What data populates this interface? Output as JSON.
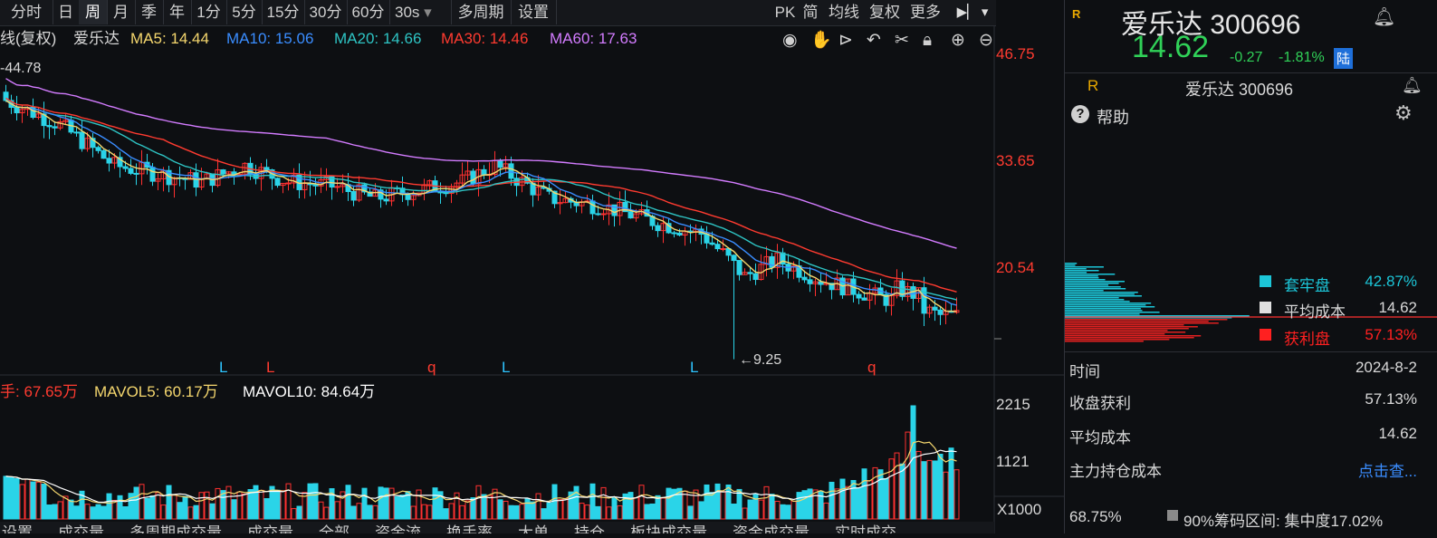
{
  "toolbar": {
    "items": [
      {
        "label": "分时"
      },
      {
        "label": "日"
      },
      {
        "label": "周"
      },
      {
        "label": "月"
      },
      {
        "label": "季"
      },
      {
        "label": "年"
      },
      {
        "label": "1分"
      },
      {
        "label": "5分"
      },
      {
        "label": "15分"
      },
      {
        "label": "30分"
      },
      {
        "label": "60分"
      },
      {
        "label": "30s"
      },
      {
        "label": "多周期"
      },
      {
        "label": "设置"
      }
    ],
    "right_items": [
      {
        "label": "PK"
      },
      {
        "label": "简"
      },
      {
        "label": "均线"
      },
      {
        "label": "复权"
      },
      {
        "label": "更多"
      }
    ],
    "active": "周"
  },
  "legend": {
    "prefix": "线(复权)",
    "name": "爱乐达",
    "ma5": "MA5: 14.44",
    "ma10": "MA10: 15.06",
    "ma20": "MA20: 14.66",
    "ma30": "MA30: 14.46",
    "ma60": "MA60: 17.63"
  },
  "vol_legend": {
    "vol": "手: 67.65万",
    "mavol5": "MAVOL5: 60.17万",
    "mavol10": "MAVOL10: 84.64万"
  },
  "colors": {
    "ma5": "#f5d76e",
    "ma10": "#3a8dff",
    "ma20": "#2ec4c4",
    "ma30": "#ff3b30",
    "ma60": "#d37cff",
    "up": "#ff3030",
    "down": "#2ad4e8",
    "axis_text": "#ff3b30"
  },
  "chart_data": {
    "type": "candlestick",
    "price_axis_ticks": [
      "46.75",
      "33.65",
      "20.54"
    ],
    "volume_axis_ticks": [
      "2215",
      "1121"
    ],
    "volume_unit": "X1000",
    "high_mark": "44.78",
    "low_mark": "9.25",
    "signal_marks": [
      "L",
      "L",
      "q",
      "L",
      "L",
      "q"
    ]
  },
  "right_panel": {
    "r_badge": "R",
    "stock_name": "爱乐达 300696",
    "price": "14.62",
    "change": "-0.27",
    "change_pct": "-1.81%",
    "lu_badge": "陆",
    "sub_name": "爱乐达 300696",
    "help": "帮助",
    "legend": [
      {
        "label": "套牢盘",
        "value": "42.87%",
        "color": "#1cc6d8"
      },
      {
        "label": "平均成本",
        "value": "14.62",
        "color": "#e0e0e0"
      },
      {
        "label": "获利盘",
        "value": "57.13%",
        "color": "#ff2020"
      }
    ],
    "info": [
      {
        "label": "时间",
        "value": "2024-8-2"
      },
      {
        "label": "收盘获利",
        "value": "57.13%"
      },
      {
        "label": "平均成本",
        "value": "14.62"
      },
      {
        "label": "主力持仓成本",
        "value": "点击查..."
      }
    ],
    "footer_left": "68.75%",
    "footer_mid": "90%筹码区间: 集中度17.02%"
  },
  "bottom_tabs": [
    "设置",
    "成交量",
    "多周期成交量",
    "成交量",
    "全部",
    "资金流",
    "换手率",
    "大单",
    "持仓",
    "板块成交量",
    "资金成交量",
    "实时成交"
  ]
}
